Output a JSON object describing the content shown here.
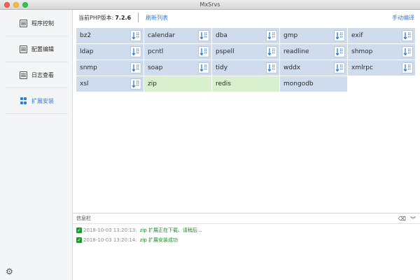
{
  "window": {
    "title": "MxSrvs"
  },
  "sidebar": {
    "items": [
      {
        "label": "程序控制",
        "icon": "program-control-icon",
        "active": false
      },
      {
        "label": "配置编辑",
        "icon": "config-edit-icon",
        "active": false
      },
      {
        "label": "日志查看",
        "icon": "log-view-icon",
        "active": false
      },
      {
        "label": "扩展安装",
        "icon": "extensions-grid-icon",
        "active": true
      }
    ],
    "settings_icon": "gear-icon"
  },
  "toolbar": {
    "php_label": "当前PHP版本:",
    "php_version": "7.2.6",
    "refresh_label": "刷新列表",
    "compile_label": "手动编译"
  },
  "extensions": [
    {
      "name": "bz2",
      "status": "available"
    },
    {
      "name": "calendar",
      "status": "available"
    },
    {
      "name": "dba",
      "status": "available"
    },
    {
      "name": "gmp",
      "status": "available"
    },
    {
      "name": "exif",
      "status": "available"
    },
    {
      "name": "ldap",
      "status": "available"
    },
    {
      "name": "pcntl",
      "status": "available"
    },
    {
      "name": "pspell",
      "status": "available"
    },
    {
      "name": "readline",
      "status": "available"
    },
    {
      "name": "shmop",
      "status": "available"
    },
    {
      "name": "snmp",
      "status": "available"
    },
    {
      "name": "soap",
      "status": "available"
    },
    {
      "name": "tidy",
      "status": "available"
    },
    {
      "name": "wddx",
      "status": "available"
    },
    {
      "name": "xmlrpc",
      "status": "available"
    },
    {
      "name": "xsl",
      "status": "available"
    },
    {
      "name": "zip",
      "status": "installed"
    },
    {
      "name": "redis",
      "status": "installed"
    },
    {
      "name": "mongodb",
      "status": "plain"
    }
  ],
  "info": {
    "title": "信息栏",
    "logs": [
      {
        "time": "2018-10-03 13:20:13:",
        "message": "zip 扩展正在下载、请稍后..."
      },
      {
        "time": "2018-10-03 13:20:14:",
        "message": "zip 扩展安装成功"
      }
    ]
  },
  "colors": {
    "accent": "#2c7bd8",
    "available_cell": "#cfdcee",
    "installed_cell": "#d9f0cf",
    "log_success": "#1e8a26"
  }
}
